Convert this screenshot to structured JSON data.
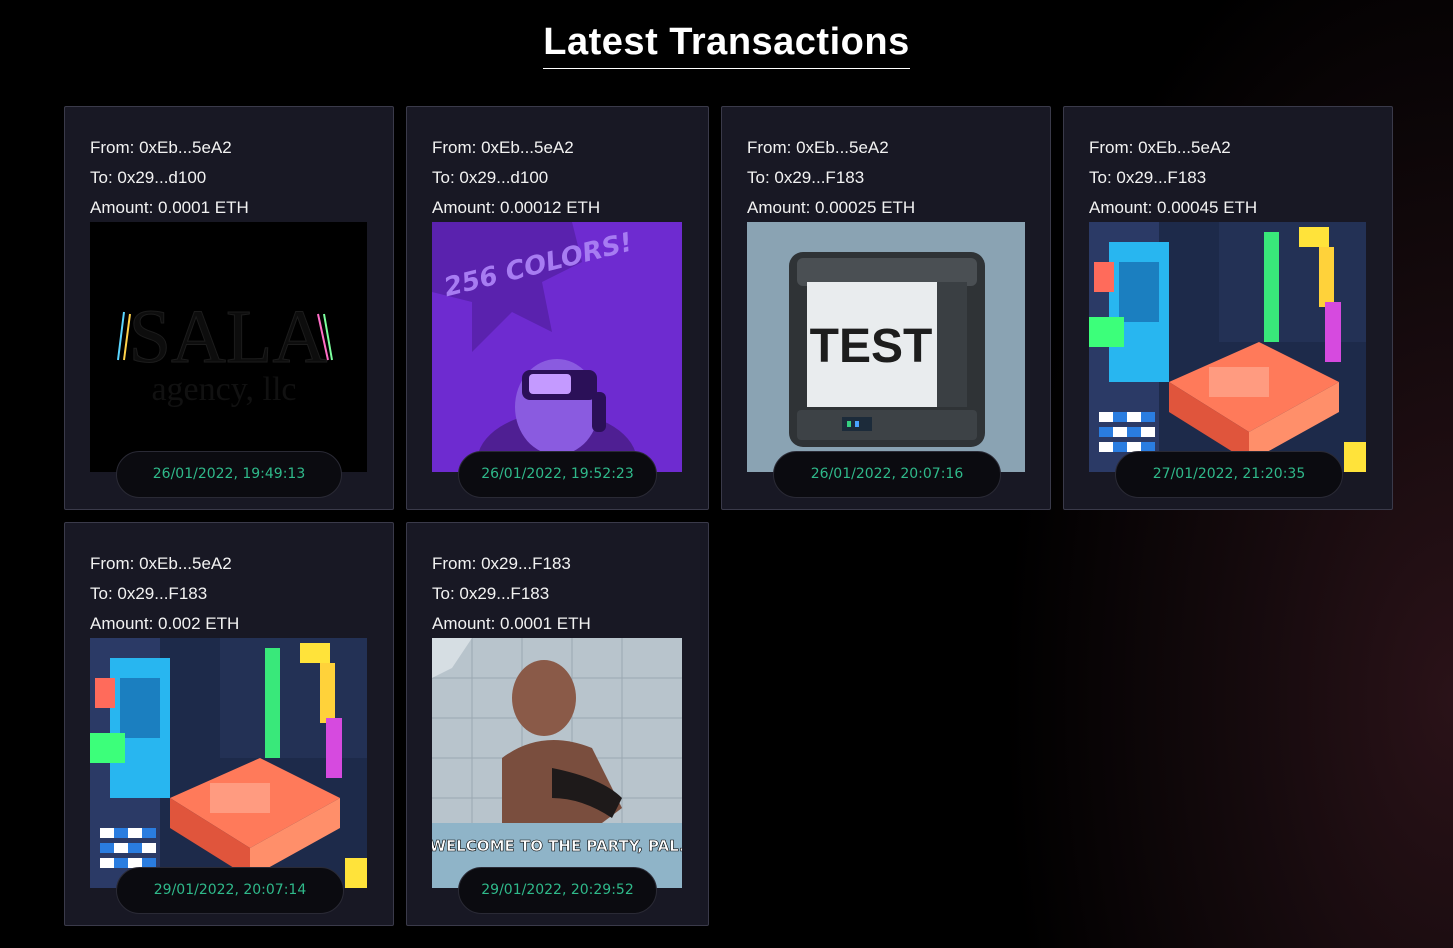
{
  "page": {
    "title": "Latest Transactions"
  },
  "transactions": [
    {
      "from": "From: 0xEb...5eA2",
      "to": "To: 0x29...d100",
      "amount": "Amount: 0.0001 ETH",
      "timestamp": "26/01/2022, 19:49:13",
      "gif": "sala-agency-logo"
    },
    {
      "from": "From: 0xEb...5eA2",
      "to": "To: 0x29...d100",
      "amount": "Amount: 0.00012 ETH",
      "timestamp": "26/01/2022, 19:52:23",
      "gif": "vr-headset-256-colors",
      "gif_caption": "256 COLORS!"
    },
    {
      "from": "From: 0xEb...5eA2",
      "to": "To: 0x29...F183",
      "amount": "Amount: 0.00025 ETH",
      "timestamp": "26/01/2022, 20:07:16",
      "gif": "test-printer",
      "gif_caption": "TEST"
    },
    {
      "from": "From: 0xEb...5eA2",
      "to": "To: 0x29...F183",
      "amount": "Amount: 0.00045 ETH",
      "timestamp": "27/01/2022, 21:20:35",
      "gif": "isometric-pixel-room"
    },
    {
      "from": "From: 0xEb...5eA2",
      "to": "To: 0x29...F183",
      "amount": "Amount: 0.002 ETH",
      "timestamp": "29/01/2022, 20:07:14",
      "gif": "isometric-pixel-room"
    },
    {
      "from": "From: 0x29...F183",
      "to": "To: 0x29...F183",
      "amount": "Amount: 0.0001 ETH",
      "timestamp": "29/01/2022, 20:29:52",
      "gif": "welcome-to-the-party-pal",
      "gif_caption": "WELCOME TO THE PARTY, PAL."
    }
  ],
  "colors": {
    "card_bg": "#181824",
    "timestamp_text": "#2fb98a",
    "timestamp_bg": "#0b0b10"
  }
}
